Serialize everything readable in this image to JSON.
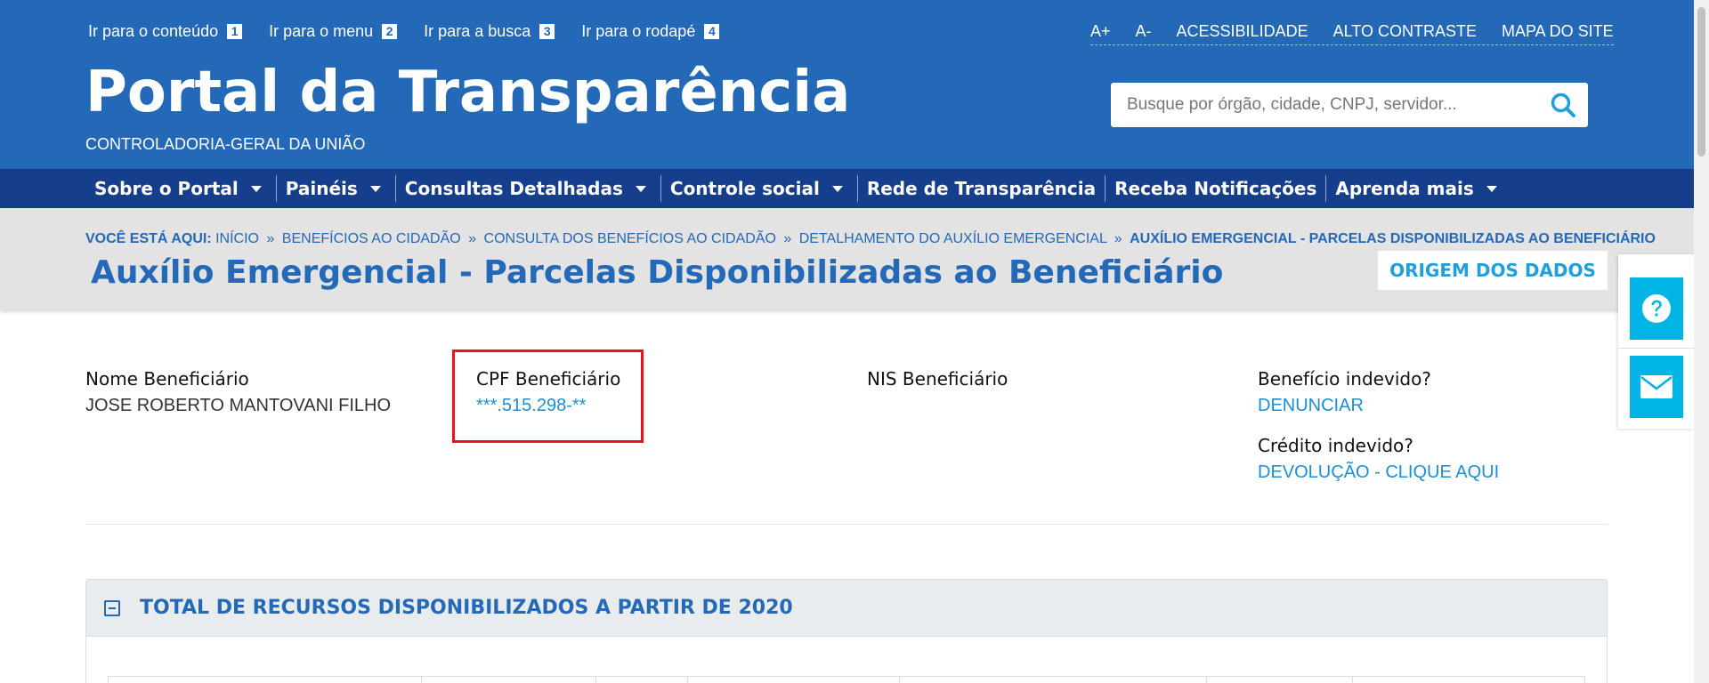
{
  "header": {
    "skip_links": [
      {
        "label": "Ir para o conteúdo",
        "num": "1"
      },
      {
        "label": "Ir para o menu",
        "num": "2"
      },
      {
        "label": "Ir para a busca",
        "num": "3"
      },
      {
        "label": "Ir para o rodapé",
        "num": "4"
      }
    ],
    "util_links": [
      "A+",
      "A-",
      "ACESSIBILIDADE",
      "ALTO CONTRASTE",
      "MAPA DO SITE"
    ],
    "title": "Portal da Transparência",
    "subtitle": "CONTROLADORIA-GERAL DA UNIÃO",
    "search": {
      "placeholder": "Busque por órgão, cidade, CNPJ, servidor..."
    }
  },
  "nav": {
    "items": [
      {
        "label": "Sobre o Portal",
        "dropdown": true
      },
      {
        "label": "Painéis",
        "dropdown": true
      },
      {
        "label": "Consultas Detalhadas",
        "dropdown": true
      },
      {
        "label": "Controle social",
        "dropdown": true
      },
      {
        "label": "Rede de Transparência",
        "dropdown": false
      },
      {
        "label": "Receba Notificações",
        "dropdown": false
      },
      {
        "label": "Aprenda mais",
        "dropdown": true
      }
    ]
  },
  "breadcrumb": {
    "prefix": "VOCÊ ESTÁ AQUI:",
    "items": [
      "INÍCIO",
      "BENEFÍCIOS AO CIDADÃO",
      "CONSULTA DOS BENEFÍCIOS AO CIDADÃO",
      "DETALHAMENTO DO AUXÍLIO EMERGENCIAL"
    ],
    "separator": "»",
    "current": "AUXÍLIO EMERGENCIAL - PARCELAS DISPONIBILIZADAS AO BENEFICIÁRIO"
  },
  "page": {
    "title": "Auxílio Emergencial - Parcelas Disponibilizadas ao Beneficiário",
    "origin_button": "ORIGEM DOS DADOS"
  },
  "beneficiary": {
    "name_label": "Nome Beneficiário",
    "name_value": "JOSE ROBERTO MANTOVANI FILHO",
    "cpf_label": "CPF Beneficiário",
    "cpf_value": "***.515.298-**",
    "nis_label": "NIS Beneficiário",
    "undue_benefit_label": "Benefício indevido?",
    "undue_benefit_link": "DENUNCIAR",
    "undue_credit_label": "Crédito indevido?",
    "undue_credit_link": "DEVOLUÇÃO - CLIQUE AQUI"
  },
  "section": {
    "title": "TOTAL DE RECURSOS DISPONIBILIZADOS A PARTIR DE 2020"
  },
  "colors": {
    "header_blue": "#2369b7",
    "nav_blue": "#153e8c",
    "accent_cyan": "#00b4e6",
    "link_blue": "#1a8fd6",
    "highlight_red": "#e8131b"
  },
  "icons": {
    "search": "search-icon",
    "help": "question-circle-icon",
    "mail": "envelope-icon",
    "collapse": "minus-square-icon"
  }
}
